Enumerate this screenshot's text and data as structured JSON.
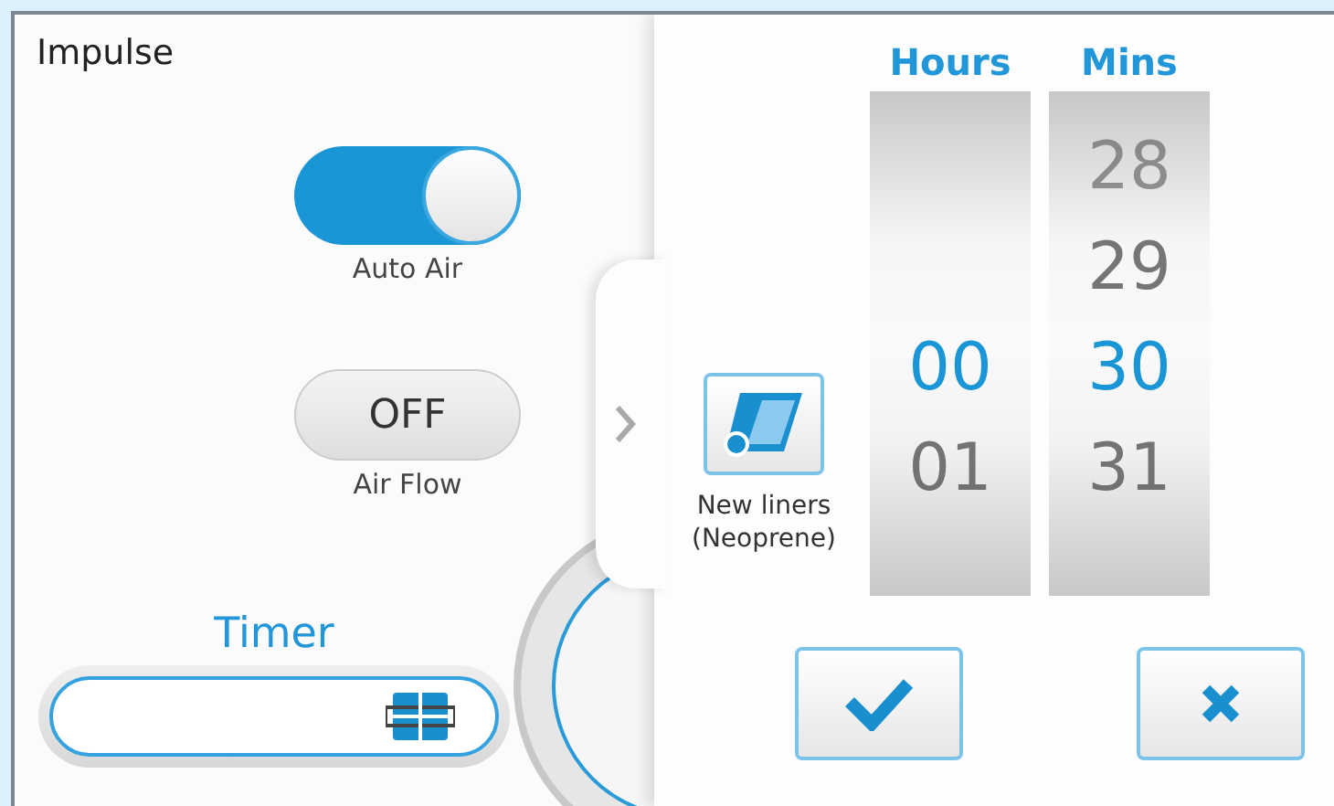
{
  "title": "Impulse",
  "auto_air": {
    "label": "Auto Air",
    "on": true
  },
  "air_flow": {
    "value": "OFF",
    "label": "Air Flow"
  },
  "timer": {
    "label": "Timer"
  },
  "liners_button": {
    "label": "New liners\n(Neoprene)"
  },
  "wheels": [
    {
      "header": "Hours",
      "items": [
        {
          "text": "00",
          "selected": true
        },
        {
          "text": "01",
          "selected": false
        }
      ]
    },
    {
      "header": "Mins",
      "items": [
        {
          "text": "28",
          "selected": false
        },
        {
          "text": "29",
          "selected": false
        },
        {
          "text": "30",
          "selected": true
        },
        {
          "text": "31",
          "selected": false
        }
      ]
    }
  ]
}
